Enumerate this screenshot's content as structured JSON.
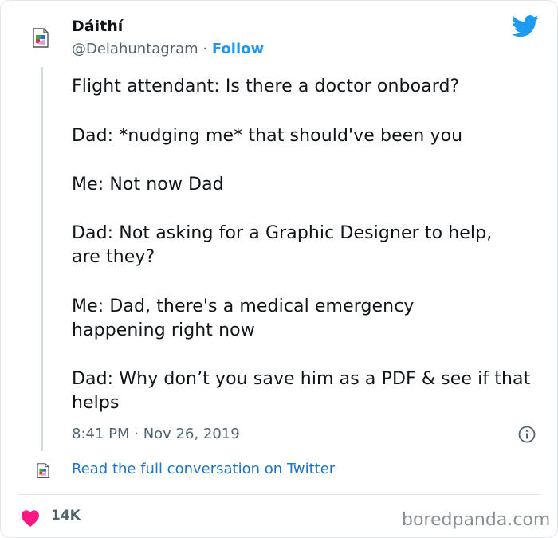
{
  "author": {
    "name": "Dáithí",
    "handle": "@Delahuntagram",
    "separator": " · ",
    "follow_label": "Follow"
  },
  "icons": {
    "avatar": "broken-image-icon",
    "platform": "twitter-bird-icon",
    "info": "info-icon",
    "like": "heart-icon"
  },
  "colors": {
    "twitter_blue": "#1d9bf0",
    "heart_red": "#f91880",
    "secondary_text": "#536471"
  },
  "tweet": {
    "paragraphs": [
      "Flight attendant: Is there a doctor onboard?",
      "Dad: *nudging me* that should've been you",
      "Me: Not now Dad",
      "Dad: Not asking for a Graphic Designer to help, are they?",
      "Me: Dad, there's a medical emergency happening right now",
      "Dad: Why don’t you save him as a PDF & see if that helps"
    ],
    "timestamp": "8:41 PM · Nov 26, 2019"
  },
  "conversation_link": "Read the full conversation on Twitter",
  "likes_count": "14K",
  "watermark": "boredpanda.com"
}
